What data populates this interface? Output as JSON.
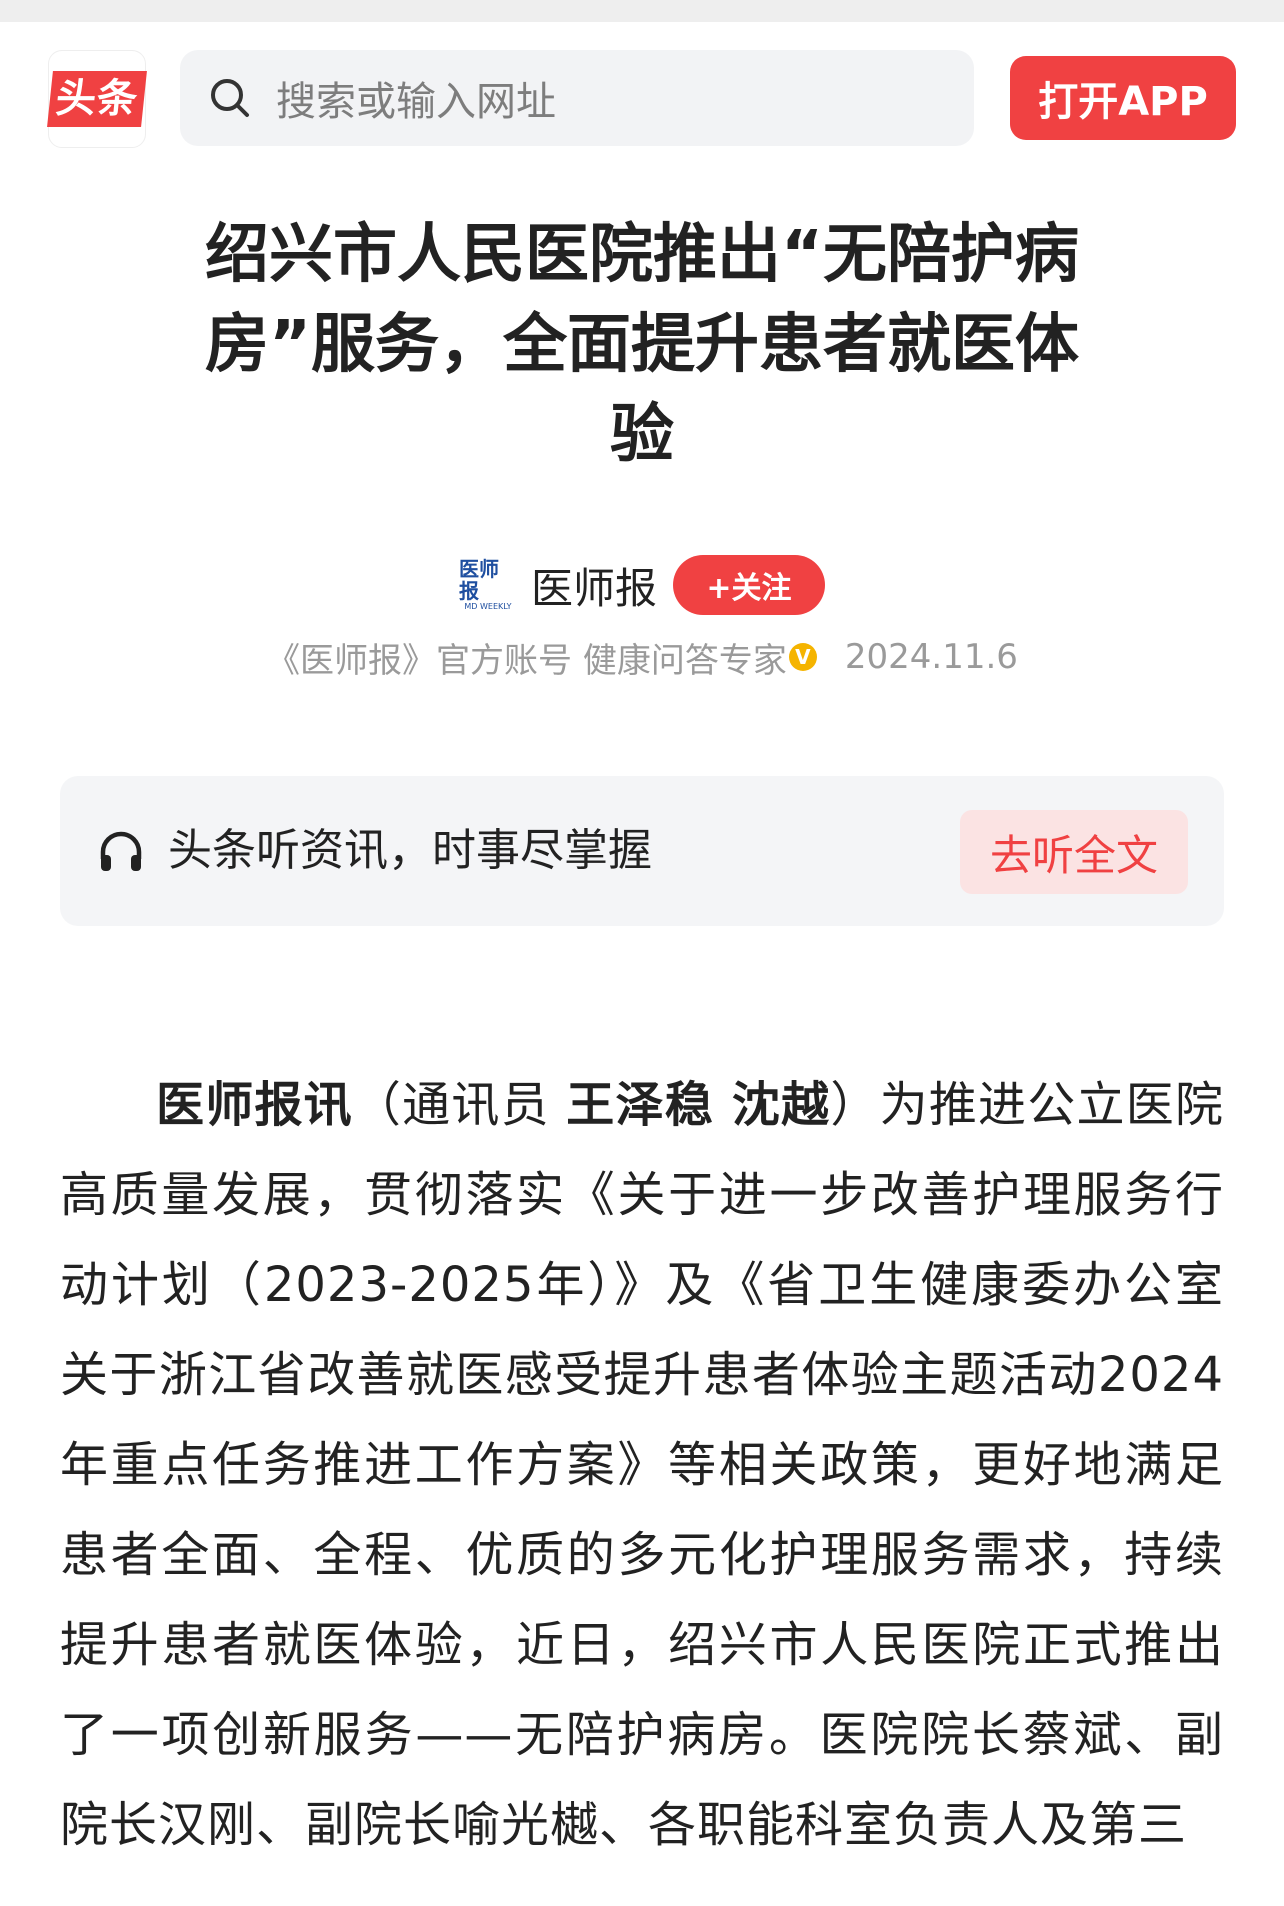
{
  "topbar": {
    "logo_text": "头条",
    "search_placeholder": "搜索或输入网址",
    "open_app_label": "打开APP"
  },
  "article": {
    "title": "绍兴市人民医院推出“无陪护病房”服务，全面提升患者就医体验",
    "author": {
      "avatar_text": "医师报",
      "avatar_subtext": "MD WEEKLY",
      "name": "医师报",
      "follow_label": "+关注",
      "description": "《医师报》官方账号 健康问答专家",
      "verified_mark": "V",
      "date": "2024.11.6"
    },
    "listen_banner": {
      "text": "头条听资讯，时事尽掌握",
      "button_label": "去听全文"
    },
    "body": {
      "lead_bold": "医师报讯",
      "paren_open": "（通讯员 ",
      "reporters": "王泽稳 沈越",
      "paren_close": "）",
      "text": "为推进公立医院高质量发展，贯彻落实《关于进一步改善护理服务行动计划（2023-2025年）》及《省卫生健康委办公室关于浙江省改善就医感受提升患者体验主题活动2024年重点任务推进工作方案》等相关政策，更好地满足患者全面、全程、优质的多元化护理服务需求，持续提升患者就医体验，近日，绍兴市人民医院正式推出了一项创新服务——无陪护病房。医院院长蔡斌、副院长汉刚、副院长喻光樾、各职能科室负责人及第三"
    }
  }
}
